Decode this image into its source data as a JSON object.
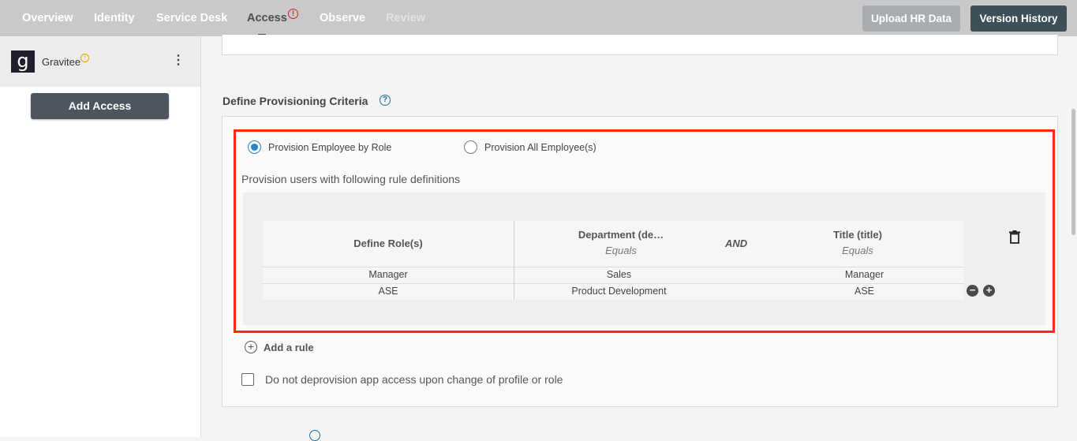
{
  "nav": {
    "tabs": [
      {
        "label": "Overview"
      },
      {
        "label": "Identity"
      },
      {
        "label": "Service Desk"
      },
      {
        "label": "Access"
      },
      {
        "label": "Observe"
      },
      {
        "label": "Review"
      }
    ],
    "active_tab": "Access",
    "alert_glyph": "!",
    "upload_label": "Upload HR Data",
    "version_label": "Version History"
  },
  "sidebar": {
    "app_name": "Gravitee",
    "app_logo_glyph": "g",
    "warn_glyph": "!",
    "kebab_glyph": "⋮",
    "add_access_label": "Add Access"
  },
  "main": {
    "section_title": "Define Provisioning Criteria",
    "help_glyph": "?",
    "radio_by_role": "Provision Employee by Role",
    "radio_all": "Provision All Employee(s)",
    "radio_selected": "by_role",
    "rule_description": "Provision users with following rule definitions",
    "table": {
      "headers": [
        {
          "title": "Define Role(s)",
          "sub": ""
        },
        {
          "title": "Department (de…",
          "sub": "Equals"
        },
        {
          "title": "Title (title)",
          "sub": "Equals"
        }
      ],
      "operator": "AND",
      "rows": [
        {
          "role": "Manager",
          "department": "Sales",
          "title": "Manager"
        },
        {
          "role": "ASE",
          "department": "Product Development",
          "title": "ASE"
        }
      ]
    },
    "remove_glyph": "−",
    "add_glyph": "+",
    "add_rule_label": "Add a rule",
    "deprovision_label": "Do not deprovision app access upon change of profile or role",
    "deprovision_checked": false
  },
  "colors": {
    "highlight": "#ff2a0a",
    "accent": "#2b84c6",
    "nav_bg": "#c9c9c9",
    "version_btn": "#3d5058"
  }
}
